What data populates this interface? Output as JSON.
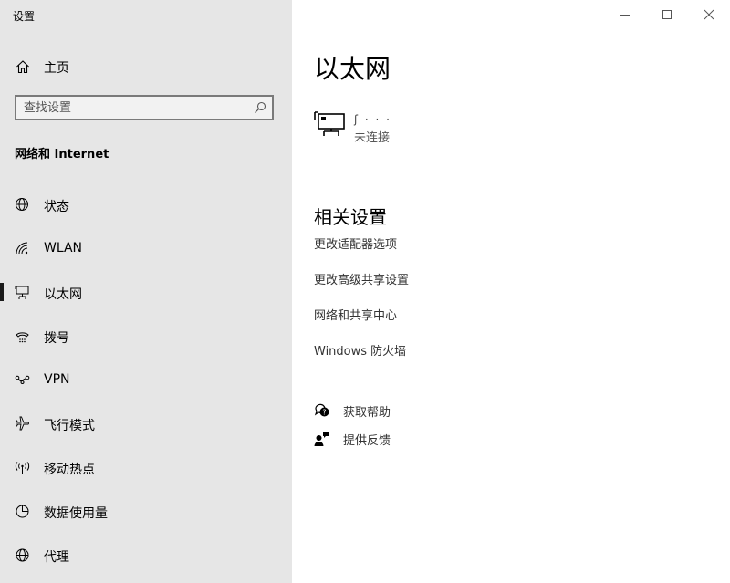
{
  "app": {
    "title": "设置"
  },
  "sidebar": {
    "home_label": "主页",
    "search_placeholder": "查找设置",
    "section_title": "网络和 Internet",
    "items": [
      {
        "label": "状态",
        "icon": "globe-status-icon"
      },
      {
        "label": "WLAN",
        "icon": "wifi-icon"
      },
      {
        "label": "以太网",
        "icon": "ethernet-icon",
        "active": true
      },
      {
        "label": "拨号",
        "icon": "dialup-icon"
      },
      {
        "label": "VPN",
        "icon": "vpn-icon"
      },
      {
        "label": "飞行模式",
        "icon": "airplane-icon"
      },
      {
        "label": "移动热点",
        "icon": "hotspot-icon"
      },
      {
        "label": "数据使用量",
        "icon": "data-usage-icon"
      },
      {
        "label": "代理",
        "icon": "globe-proxy-icon"
      }
    ]
  },
  "main": {
    "title": "以太网",
    "connection": {
      "name": "ʃ  ·  ·  ·",
      "status": "未连接"
    },
    "related_title": "相关设置",
    "related_links": [
      "更改适配器选项",
      "更改高级共享设置",
      "网络和共享中心",
      "Windows 防火墙"
    ],
    "help": [
      {
        "label": "获取帮助",
        "icon": "help-chat-icon"
      },
      {
        "label": "提供反馈",
        "icon": "feedback-icon"
      }
    ]
  }
}
